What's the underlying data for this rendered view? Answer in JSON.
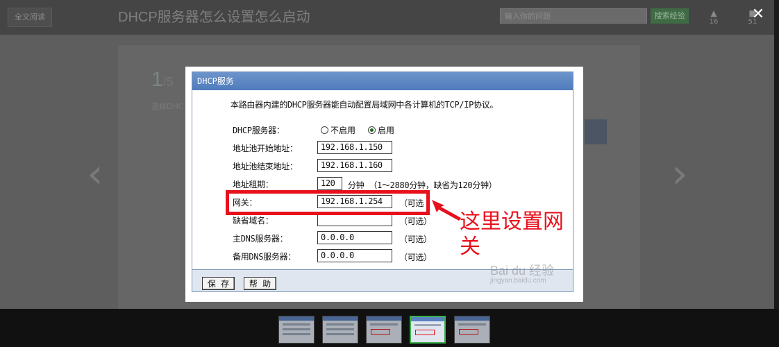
{
  "viewer": {
    "full_text_button": "全文阅读",
    "title": "DHCP服务器怎么设置怎么启动",
    "search_placeholder": "输入你的问题",
    "search_button": "搜索经验",
    "likes_count": "16",
    "comments_count": "51",
    "step_current": "1",
    "step_total": "/5",
    "step_text": "选择DHC",
    "prev_icon": "chevron-left-icon",
    "next_icon": "chevron-right-icon",
    "close_icon": "close-icon"
  },
  "dialog": {
    "title": "DHCP服务",
    "description": "本路由器内建的DHCP服务器能自动配置局域网中各计算机的TCP/IP协议。",
    "server_label": "DHCP服务器：",
    "radio_off_label": "不启用",
    "radio_on_label": "启用",
    "selected": "启用",
    "fields": [
      {
        "label": "地址池开始地址：",
        "value": "192.168.1.150",
        "optional": ""
      },
      {
        "label": "地址池结束地址：",
        "value": "192.168.1.160",
        "optional": ""
      },
      {
        "label": "地址租期：",
        "value": "120",
        "optional": "分钟 （1～2880分钟，缺省为120分钟）"
      },
      {
        "label": "网关：",
        "value": "192.168.1.254",
        "optional": "（可选"
      },
      {
        "label": "缺省域名：",
        "value": "",
        "optional": "（可选）"
      },
      {
        "label": "主DNS服务器：",
        "value": "0.0.0.0",
        "optional": "（可选）"
      },
      {
        "label": "备用DNS服务器：",
        "value": "0.0.0.0",
        "optional": "（可选）"
      }
    ],
    "save_button": "保 存",
    "help_button": "帮 助"
  },
  "annotation": {
    "text": "这里设置网关",
    "color": "#e8101c"
  },
  "watermark": {
    "brand": "Bai du 经验",
    "url": "jingyan.baidu.com"
  },
  "thumbnails": {
    "count": 5,
    "active_index": 3
  },
  "colors": {
    "title_bar": "#5a84c4",
    "accent_green": "#38b24a"
  }
}
